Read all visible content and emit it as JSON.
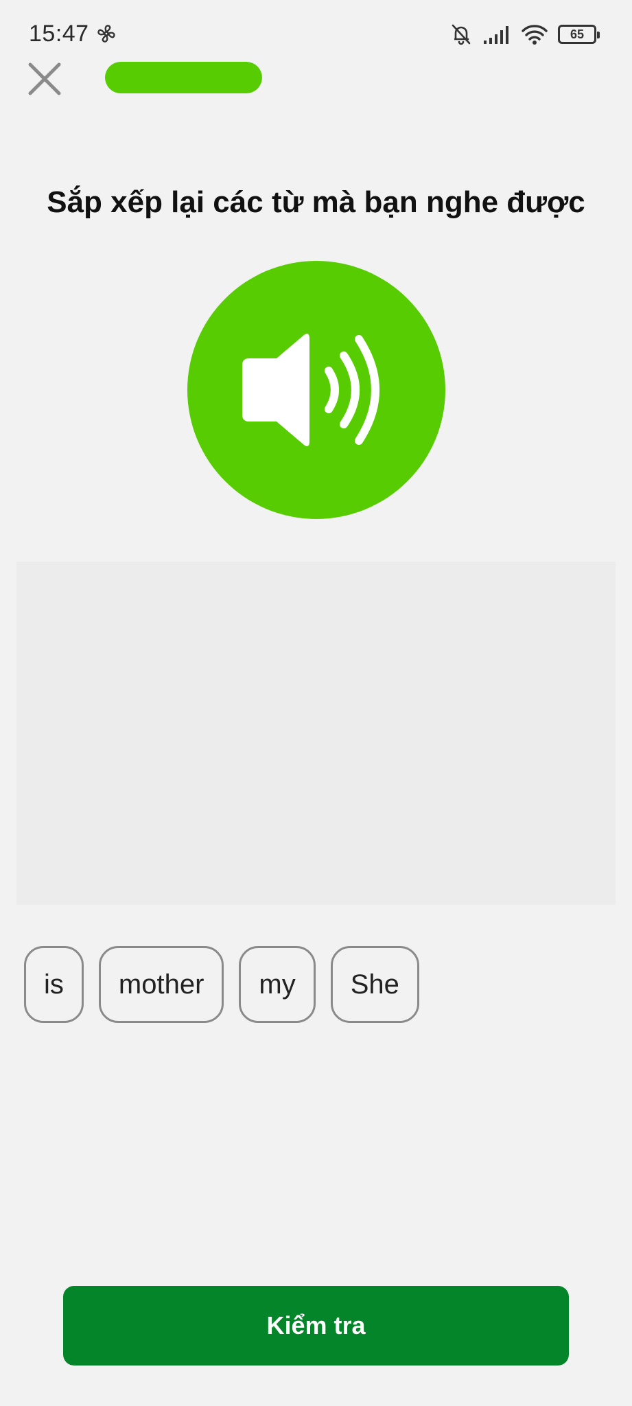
{
  "status_bar": {
    "time": "15:47",
    "battery": "65",
    "icons": [
      "fan-icon",
      "bell-off-icon",
      "signal-icon",
      "wifi-icon",
      "battery-icon"
    ]
  },
  "header": {
    "close_icon": "close-icon",
    "progress": 1.0
  },
  "prompt": "Sắp xếp lại các từ mà bạn nghe được",
  "audio_button": {
    "icon": "speaker-icon"
  },
  "answer_area": {
    "words": []
  },
  "word_bank": [
    "is",
    "mother",
    "my",
    "She"
  ],
  "check_button": {
    "label": "Kiểm tra"
  },
  "colors": {
    "accent": "#58cc02",
    "primary_button": "#058529",
    "background": "#f2f2f2",
    "chip_border": "#8a8a8a"
  }
}
